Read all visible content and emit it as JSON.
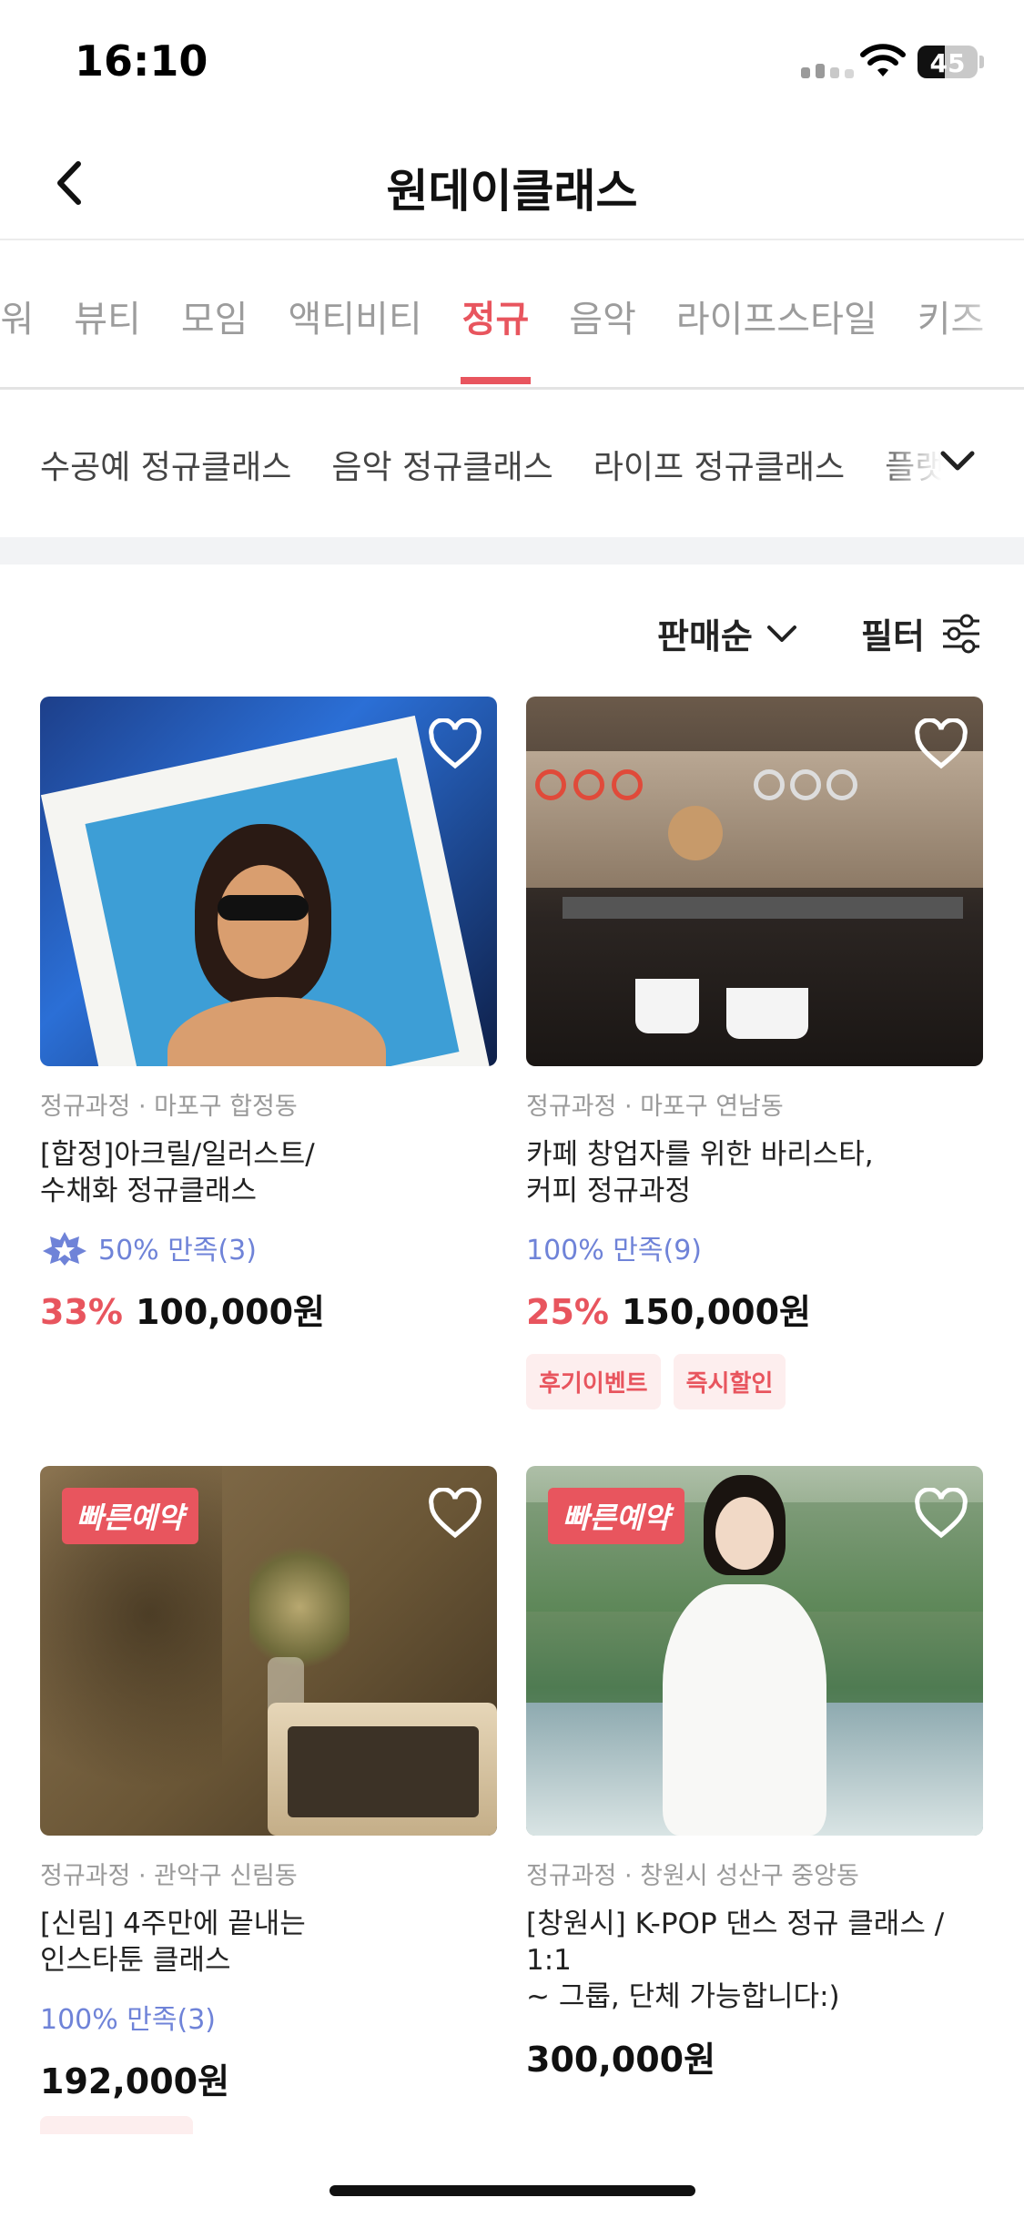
{
  "status_bar": {
    "time": "16:10",
    "battery": "45",
    "battery_level": 0.45
  },
  "header": {
    "title": "원데이클래스"
  },
  "category_tabs": [
    "-워",
    "뷰티",
    "모임",
    "액티비티",
    "정규",
    "음악",
    "라이프스타일",
    "키즈"
  ],
  "active_category": "정규",
  "sub_tabs": [
    "수공예 정규클래스",
    "음악 정규클래스",
    "라이프 정규클래스",
    "플랫"
  ],
  "sort": {
    "label": "판매순"
  },
  "filter": {
    "label": "필터"
  },
  "products": [
    {
      "meta": "정규과정 · 마포구 합정동",
      "title_line1": "[합정]아크릴/일러스트/",
      "title_line2": "수채화 정규클래스",
      "rating": "50% 만족(3)",
      "discount": "33%",
      "price": "100,000원"
    },
    {
      "meta": "정규과정 · 마포구 연남동",
      "title_line1": "카페 창업자를 위한 바리스타,",
      "title_line2": "커피 정규과정",
      "rating": "100% 만족(9)",
      "discount": "25%",
      "price": "150,000원",
      "tags": [
        "후기이벤트",
        "즉시할인"
      ]
    },
    {
      "badge": "빠른예약",
      "meta": "정규과정 · 관악구 신림동",
      "title_line1": "[신림] 4주만에 끝내는",
      "title_line2": "인스타툰 클래스",
      "rating": "100% 만족(3)",
      "price": "192,000원"
    },
    {
      "badge": "빠른예약",
      "meta": "정규과정 · 창원시 성산구 중앙동",
      "title_line1": "[창원시] K-POP 댄스 정규 클래스 / 1:1",
      "title_line2": "~ 그룹, 단체 가능합니다:)",
      "price": "300,000원"
    }
  ],
  "colors": {
    "accent": "#e8555e",
    "rating": "#6f83d8",
    "tag_bg": "#fdeeee"
  }
}
